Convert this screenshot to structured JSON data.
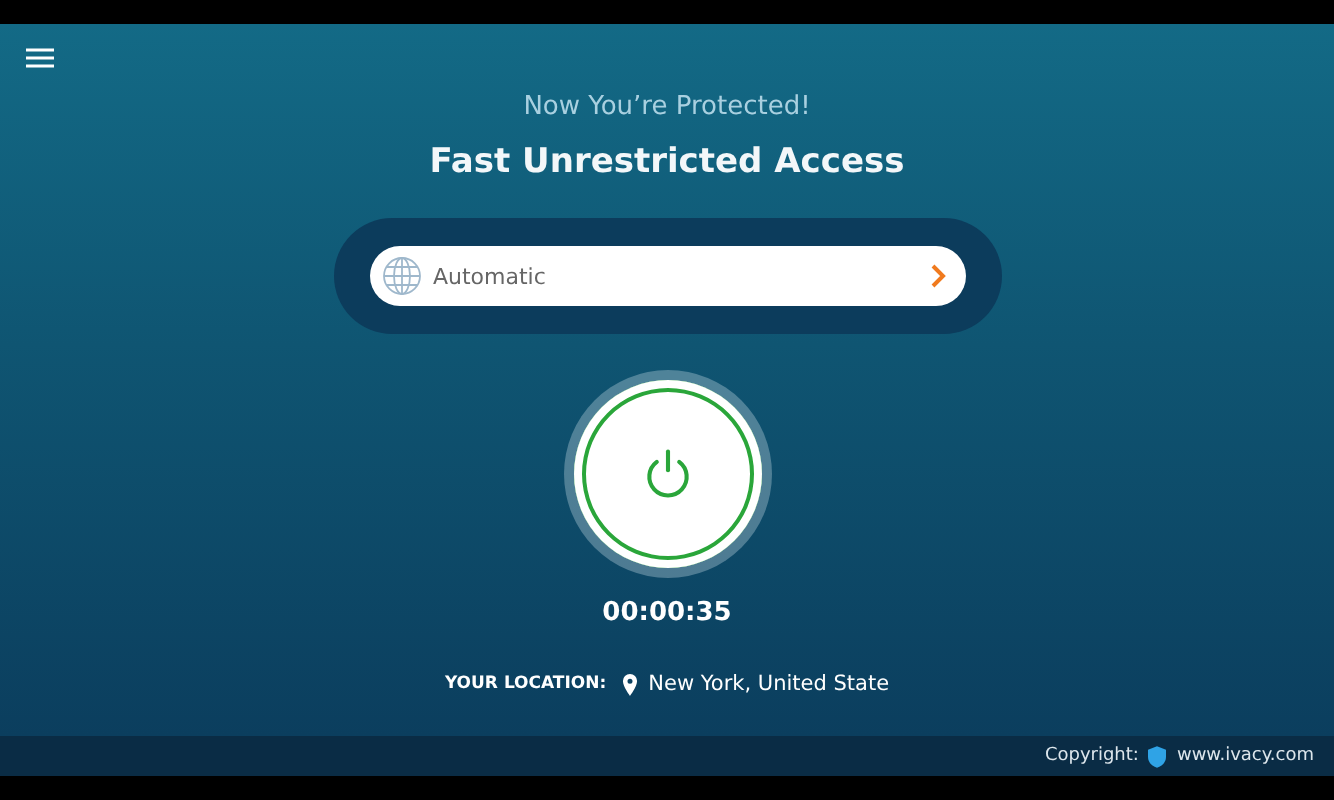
{
  "status": "Now You’re Protected!",
  "headline": "Fast Unrestricted Access",
  "server_selector": {
    "value": "Automatic"
  },
  "power_button": {
    "connected": true
  },
  "timer": "00:00:35",
  "location": {
    "label": "YOUR LOCATION:",
    "value": "New York, United State"
  },
  "footer": {
    "label": "Copyright:",
    "link": "www.ivacy.com"
  }
}
